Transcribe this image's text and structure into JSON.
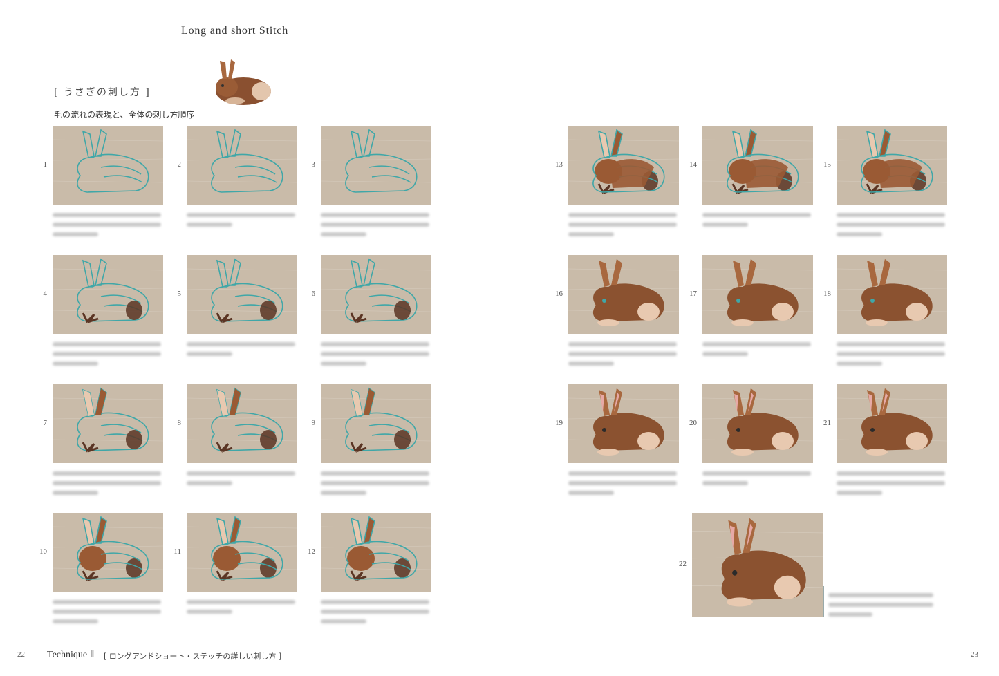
{
  "header": {
    "title": "Long and short Stitch"
  },
  "section": {
    "title": "[ うさぎの刺し方 ]",
    "subtitle": "毛の流れの表現と、全体の刺し方順序"
  },
  "steps": [
    {
      "n": "1",
      "stage": 0
    },
    {
      "n": "2",
      "stage": 0
    },
    {
      "n": "3",
      "stage": 0
    },
    {
      "n": "4",
      "stage": 1
    },
    {
      "n": "5",
      "stage": 1
    },
    {
      "n": "6",
      "stage": 1
    },
    {
      "n": "7",
      "stage": 2
    },
    {
      "n": "8",
      "stage": 2
    },
    {
      "n": "9",
      "stage": 2
    },
    {
      "n": "10",
      "stage": 3
    },
    {
      "n": "11",
      "stage": 3
    },
    {
      "n": "12",
      "stage": 3
    },
    {
      "n": "13",
      "stage": 4
    },
    {
      "n": "14",
      "stage": 4
    },
    {
      "n": "15",
      "stage": 4
    },
    {
      "n": "16",
      "stage": 5
    },
    {
      "n": "17",
      "stage": 5
    },
    {
      "n": "18",
      "stage": 5
    },
    {
      "n": "19",
      "stage": 6
    },
    {
      "n": "20",
      "stage": 6
    },
    {
      "n": "21",
      "stage": 6
    },
    {
      "n": "22",
      "stage": 7
    }
  ],
  "footer": {
    "page_left": "22",
    "technique": "Technique Ⅱ",
    "technique_sub": "[ ロングアンドショート・ステッチの詳しい刺し方 ]",
    "page_right": "23"
  },
  "colors": {
    "linen": "#c9bba9",
    "thread_blue": "#3fa7a8",
    "thread_brown": "#9a5a34",
    "thread_dark": "#5b3524",
    "thread_cream": "#e8c9b0"
  }
}
